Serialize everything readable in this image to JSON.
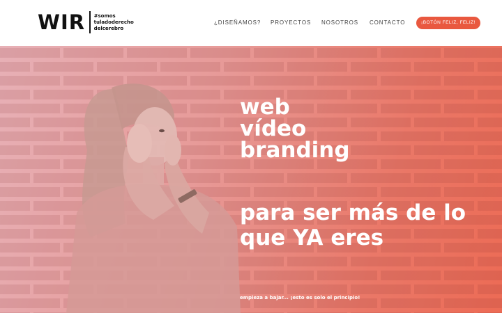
{
  "logo": {
    "mark": "WIR",
    "tagline_lines": [
      "#somos",
      "tuladoderecho",
      "delcerebro"
    ]
  },
  "nav": {
    "items": [
      "¿DISEÑAMOS?",
      "PROYECTOS",
      "NOSOTROS",
      "CONTACTO"
    ],
    "cta": "¡BOTÓN FELIZ, FELIZ!"
  },
  "hero": {
    "headline": [
      "web",
      "vídeo",
      "branding"
    ],
    "subheadline": "para ser más de lo que YA eres",
    "scroll_note": "empieza a bajar... ¡esto es solo el principio!"
  },
  "colors": {
    "accent": "#e9583f",
    "overlay_start": "#e7b0b6",
    "overlay_end": "#ec6b55",
    "text": "#111111"
  }
}
